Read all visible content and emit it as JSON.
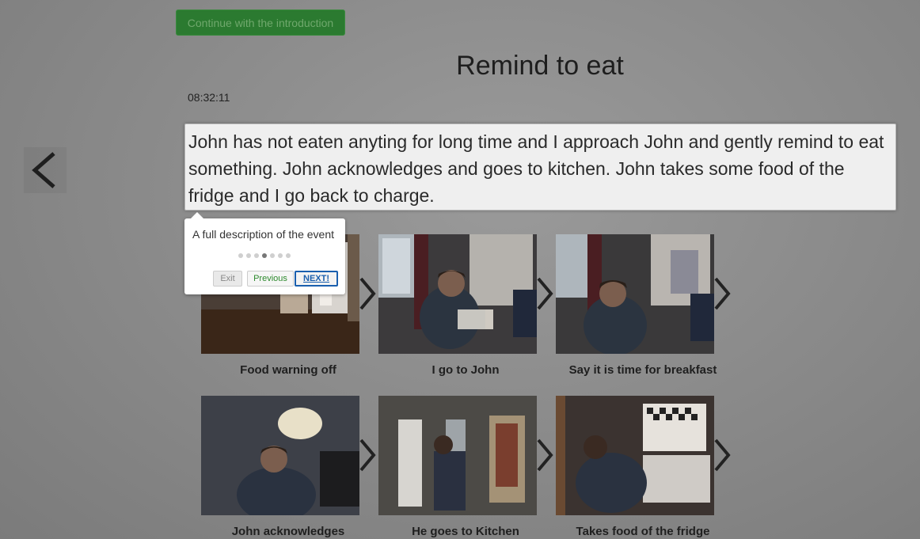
{
  "header": {
    "intro_button_label": "Continue with the introduction",
    "title": "Remind to eat",
    "time": "08:32:11"
  },
  "description": "John has not eaten anyting for long time and I approach John and gently remind to eat something. John acknowledges and goes to kitchen. John takes some food of the fridge and I go back to charge.",
  "steps": [
    {
      "caption": "Food warning off"
    },
    {
      "caption": "I go to John"
    },
    {
      "caption": "Say it is time for breakfast"
    },
    {
      "caption": "John acknowledges"
    },
    {
      "caption": "He goes to Kitchen"
    },
    {
      "caption": "Takes food of the fridge"
    }
  ],
  "tour": {
    "text": "A full description of the event",
    "step_index": 4,
    "step_total": 7,
    "exit_label": "Exit",
    "previous_label": "Previous",
    "next_label": "NEXT!"
  },
  "icons": {
    "back": "chevron-left-icon",
    "step_arrow": "chevron-right-icon"
  },
  "colors": {
    "intro_button": "#2b7a30",
    "next_button_border": "#1a5fae"
  }
}
